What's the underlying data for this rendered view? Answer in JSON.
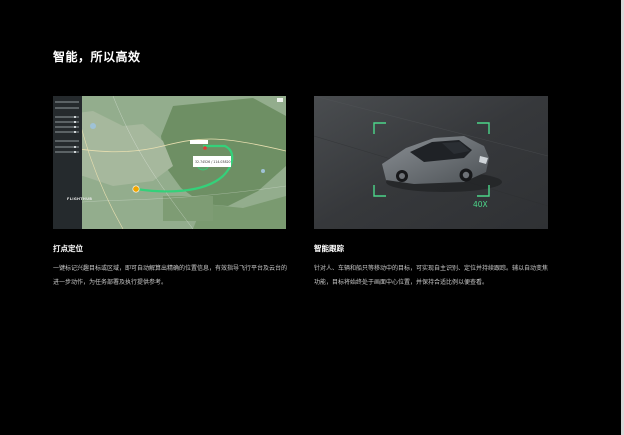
{
  "section": {
    "title": "智能，所以高效"
  },
  "features": [
    {
      "title": "打点定位",
      "description": "一键标记兴趣目标或区域，即可自动解算出精确的位置信息，有效指导飞行平台及云台的进一步动作，为任务部署及执行提供参考。",
      "image": {
        "sidebar_brand": "FLIGHTHUB",
        "marker_tooltip": "32.74526  /  114.03820",
        "colors": {
          "map_base": "#8fa888",
          "route": "#34d17a",
          "marker": "#f0a500",
          "target": "#e53935"
        }
      }
    },
    {
      "title": "智能跟踪",
      "description": "针对人、车辆和船只等移动中的目标，可实现自主识别、定位并持续跟踪。辅以自动变焦功能，目标将始终处于画面中心位置，并保持合适比例以便查看。",
      "image": {
        "zoom_label": "40X",
        "colors": {
          "frame": "#4cd68a",
          "road": "#3a3c3f",
          "car": "#6b7075"
        }
      }
    }
  ]
}
